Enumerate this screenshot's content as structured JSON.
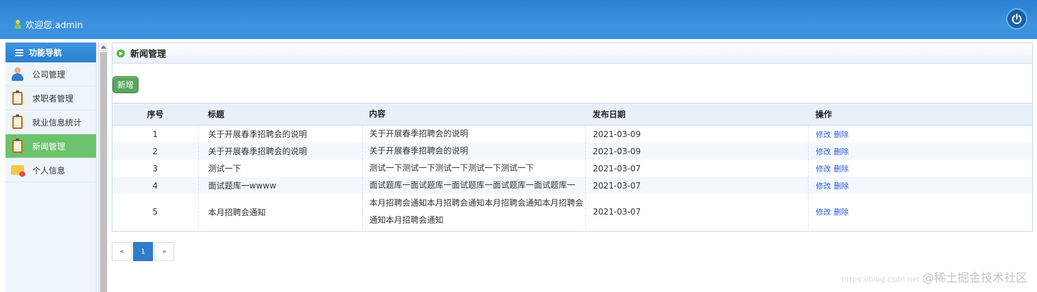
{
  "header": {
    "welcome": "欢迎您,admin"
  },
  "sidebar": {
    "title": "功能导航",
    "items": [
      {
        "label": "公司管理",
        "icon": "person-icon"
      },
      {
        "label": "求职者管理",
        "icon": "clipboard-icon"
      },
      {
        "label": "就业信息统计",
        "icon": "clipboard-icon"
      },
      {
        "label": "新闻管理",
        "icon": "clipboard-icon",
        "active": true
      },
      {
        "label": "个人信息",
        "icon": "folder-icon"
      }
    ]
  },
  "main": {
    "title": "新闻管理",
    "add_label": "新增",
    "columns": [
      "序号",
      "标题",
      "内容",
      "发布日期",
      "操作"
    ],
    "rows": [
      {
        "no": "1",
        "title": "关于开展春季招聘会的说明",
        "content": "关于开展春季招聘会的说明",
        "date": "2021-03-09"
      },
      {
        "no": "2",
        "title": "关于开展春季招聘会的说明",
        "content": "关于开展春季招聘会的说明",
        "date": "2021-03-09"
      },
      {
        "no": "3",
        "title": "测试一下",
        "content": "测试一下测试一下测试一下测试一下测试一下",
        "date": "2021-03-07"
      },
      {
        "no": "4",
        "title": "面试题库一wwww",
        "content": "面试题库一面试题库一面试题库一面试题库一面试题库一",
        "date": "2021-03-07"
      },
      {
        "no": "5",
        "title": "本月招聘会通知",
        "content": "本月招聘会通知本月招聘会通知本月招聘会通知本月招聘会通知本月招聘会通知",
        "date": "2021-03-07"
      }
    ],
    "ops": {
      "edit": "修改",
      "delete": "删除"
    },
    "pager": {
      "prev": "«",
      "current": "1",
      "next": "»"
    }
  },
  "watermark": {
    "url": "https://blog.csdn.net",
    "text": "@稀土掘金技术社区"
  },
  "colors": {
    "header": "#2a7fd0",
    "active_nav": "#6cc36b",
    "add_button": "#5aa65c",
    "pager_active": "#2f7ccb"
  }
}
